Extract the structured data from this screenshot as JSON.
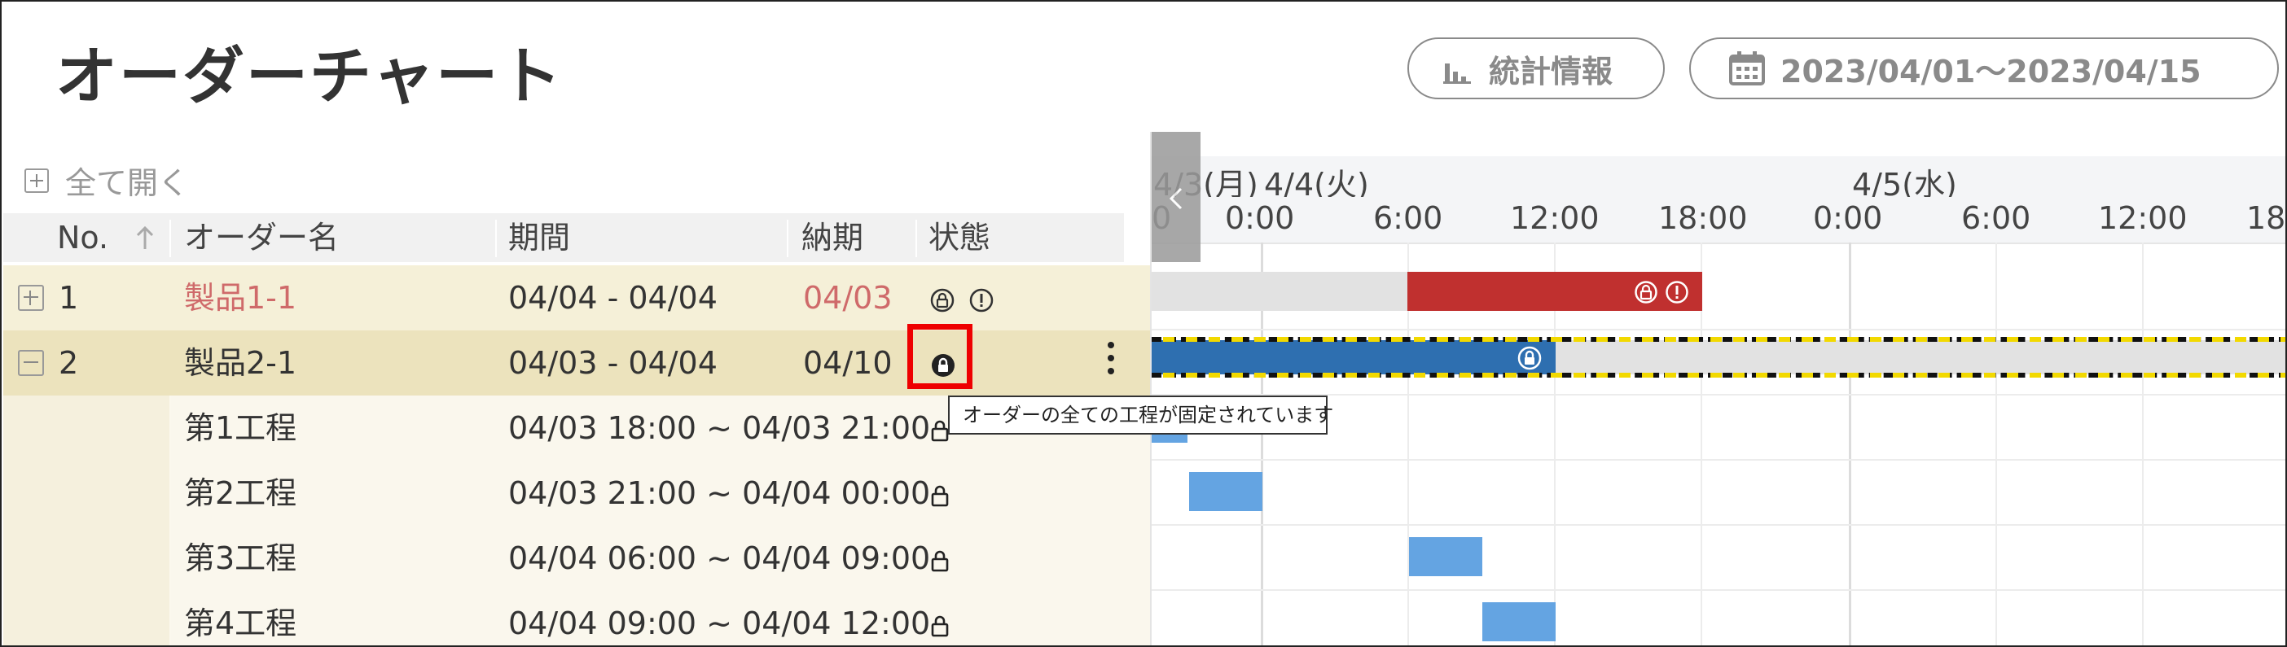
{
  "header": {
    "title": "オーダーチャート",
    "stats_label": "統計情報",
    "date_range": "2023/04/01～2023/04/15"
  },
  "left": {
    "expand_all": "全て開く",
    "columns": {
      "no": "No.",
      "name": "オーダー名",
      "period": "期間",
      "due": "納期",
      "status": "状態"
    },
    "orders": [
      {
        "no": "1",
        "name": "製品1-1",
        "period": "04/04 - 04/04",
        "due": "04/03"
      },
      {
        "no": "2",
        "name": "製品2-1",
        "period": "04/03 - 04/04",
        "due": "04/10"
      }
    ],
    "processes": [
      {
        "name": "第1工程",
        "period": "04/03 18:00 ~ 04/03 21:00"
      },
      {
        "name": "第2工程",
        "period": "04/03 21:00 ~ 04/04 00:00"
      },
      {
        "name": "第3工程",
        "period": "04/04 06:00 ~ 04/04 09:00"
      },
      {
        "name": "第4工程",
        "period": "04/04 09:00 ~ 04/04 12:00"
      }
    ]
  },
  "tooltip": "オーダーの全ての工程が固定されています",
  "gantt": {
    "dates": [
      "4/3(月)",
      "4/4(火)",
      "4/5(水)"
    ],
    "times": [
      "0",
      "0:00",
      "6:00",
      "12:00",
      "18:00",
      "0:00",
      "6:00",
      "12:00",
      "18"
    ]
  },
  "colors": {
    "accent_red": "#c0302f",
    "bar_blue": "#2e6fb0",
    "bar_light_blue": "#64a4e2",
    "highlight": "#e00000"
  }
}
